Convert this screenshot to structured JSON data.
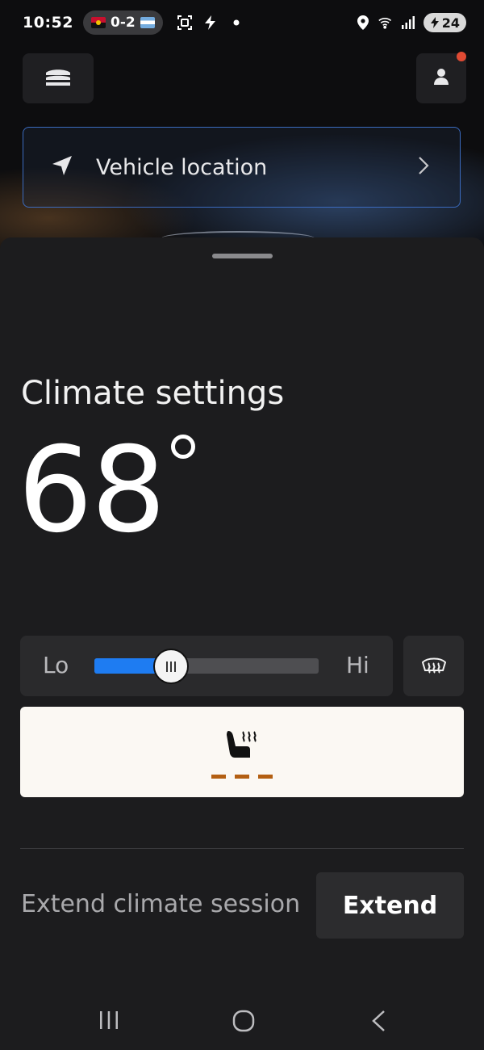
{
  "status_bar": {
    "time": "10:52",
    "score": "0-2",
    "battery": "24",
    "icons": [
      "scan-icon",
      "bolt-icon",
      "dot-icon",
      "location-pin-icon",
      "wifi-icon",
      "signal-icon",
      "battery-icon"
    ]
  },
  "header": {
    "menu_icon": "vehicles-icon",
    "profile_icon": "profile-icon",
    "notification_dot_color": "#e04a33"
  },
  "vehicle_location": {
    "label": "Vehicle location",
    "icon": "navigation-arrow-icon",
    "accent": "#3b6bbf"
  },
  "climate": {
    "title": "Climate settings",
    "temperature": "68",
    "fan": {
      "low_label": "Lo",
      "high_label": "Hi",
      "level_fraction": 0.34,
      "fill_color": "#1e7cf2"
    },
    "defrost_icon": "rear-defrost-icon",
    "seat_heater": {
      "icon": "heated-seat-icon",
      "levels_total": 3,
      "level_color": "#b35f12"
    }
  },
  "extend": {
    "label": "Extend climate session",
    "button": "Extend"
  },
  "nav": {
    "items": [
      "recent-apps-icon",
      "home-icon",
      "back-icon"
    ]
  }
}
